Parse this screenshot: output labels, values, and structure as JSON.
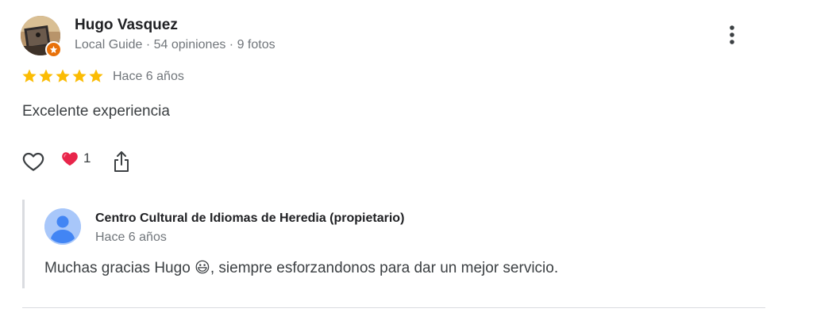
{
  "review": {
    "author": {
      "name": "Hugo Vasquez",
      "meta": "Local Guide · 54 opiniones · 9 fotos",
      "avatar_icon": "user-photo",
      "badge_icon": "local-guide-star-icon"
    },
    "rating": {
      "stars": 5,
      "max": 5,
      "star_color": "#fbbc04"
    },
    "date": "Hace 6 años",
    "text": "Excelente experiencia",
    "actions": {
      "like_icon": "heart-outline-icon",
      "reaction_icon": "red-heart-emoji",
      "reaction_count": "1",
      "share_icon": "share-icon",
      "more_icon": "more-vertical-icon"
    }
  },
  "owner_reply": {
    "owner_name": "Centro Cultural de Idiomas de Heredia (propietario)",
    "date": "Hace 6 años",
    "text": "Muchas gracias Hugo 😃, siempre esforzandonos para dar un mejor servicio.",
    "avatar_icon": "default-profile-icon",
    "avatar_color": "#a8c7fa"
  },
  "colors": {
    "text_primary": "#202124",
    "text_secondary": "#70757a",
    "badge": "#e8710a",
    "heart_red": "#e8254a",
    "divider": "#dadce0"
  }
}
